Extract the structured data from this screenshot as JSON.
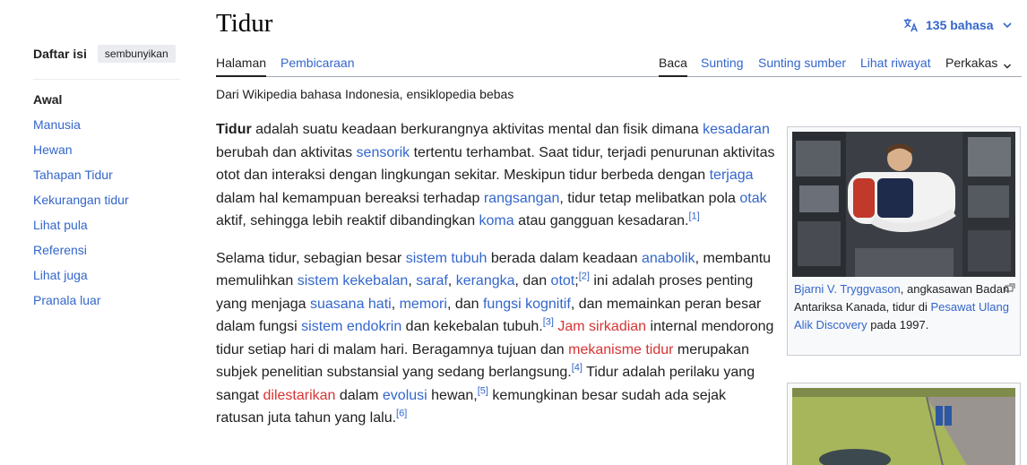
{
  "page": {
    "title": "Tidur",
    "language_count": "135 bahasa",
    "tagline": "Dari Wikipedia bahasa Indonesia, ensiklopedia bebas"
  },
  "toc": {
    "title": "Daftar isi",
    "hide_label": "sembunyikan",
    "items": [
      "Awal",
      "Manusia",
      "Hewan",
      "Tahapan Tidur",
      "Kekurangan tidur",
      "Lihat pula",
      "Referensi",
      "Lihat juga",
      "Pranala luar"
    ]
  },
  "tabs": {
    "halaman": "Halaman",
    "pembicaraan": "Pembicaraan",
    "baca": "Baca",
    "sunting": "Sunting",
    "sunting_sumber": "Sunting sumber",
    "lihat_riwayat": "Lihat riwayat",
    "perkakas": "Perkakas"
  },
  "para1": {
    "t0": "Tidur",
    "t1": " adalah suatu keadaan berkurangnya aktivitas mental dan fisik dimana ",
    "l1": "kesadaran",
    "t2": " berubah dan aktivitas ",
    "l2": "sensorik",
    "t3": " tertentu terhambat. Saat tidur, terjadi penurunan aktivitas otot dan interaksi dengan lingkungan sekitar. Meskipun tidur berbeda dengan ",
    "l3": "terjaga",
    "t4": " dalam hal kemampuan bereaksi terhadap ",
    "l4": "rangsangan",
    "t5": ", tidur tetap melibatkan pola ",
    "l5": "otak",
    "t6": " aktif, sehingga lebih reaktif dibandingkan ",
    "l6": "koma",
    "t7": " atau gangguan kesadaran.",
    "r1": "[1]"
  },
  "para2": {
    "t0": "Selama tidur, sebagian besar ",
    "l1": "sistem tubuh",
    "t1": " berada dalam keadaan ",
    "l2": "anabolik",
    "t2": ", membantu memulihkan ",
    "l3": "sistem kekebalan",
    "t3": ", ",
    "l4": "saraf",
    "t4": ", ",
    "l5": "kerangka",
    "t5": ", dan ",
    "l6": "otot",
    "t6": ";",
    "r2": "[2]",
    "t7": " ini adalah proses penting yang menjaga ",
    "l7": "suasana hati",
    "t8": ", ",
    "l8": "memori",
    "t9": ", dan ",
    "l9": "fungsi kognitif",
    "t10": ", dan memainkan peran besar dalam fungsi ",
    "l10": "sistem endokrin",
    "t11": " dan kekebalan tubuh.",
    "r3": "[3]",
    "t12": " ",
    "l11": "Jam sirkadian",
    "t13": " internal mendorong tidur setiap hari di malam hari. Beragamnya tujuan dan ",
    "l12": "mekanisme tidur",
    "t14": " merupakan subjek penelitian substansial yang sedang berlangsung.",
    "r4": "[4]",
    "t15": " Tidur adalah perilaku yang sangat ",
    "l13": "dilestarikan",
    "t16": " dalam ",
    "l14": "evolusi",
    "t17": " hewan,",
    "r5": "[5]",
    "t18": " kemungkinan besar sudah ada sejak ratusan juta tahun yang lalu.",
    "r6": "[6]"
  },
  "figure1": {
    "caption_link1": "Bjarni V. Tryggvason",
    "caption_t1": ", angkasawan Badan Antariksa Kanada, tidur di ",
    "caption_link2": "Pesawat Ulang Alik Discovery",
    "caption_t2": " pada 1997."
  },
  "icons": {
    "language": "translate-icon",
    "chevron": "chevron-down-icon",
    "magnify": "enlarge-icon"
  },
  "colors": {
    "link": "#3366cc",
    "redlink": "#d73333",
    "text": "#202122"
  }
}
